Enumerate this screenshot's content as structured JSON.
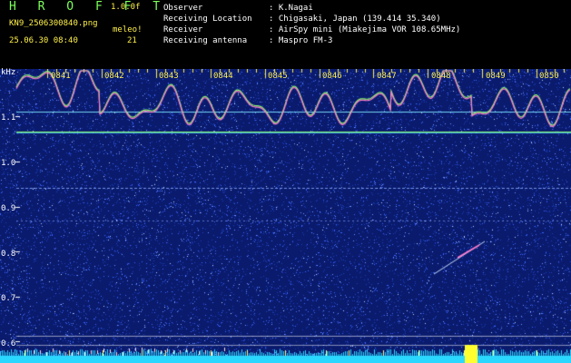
{
  "header": {
    "app_title": "H R O F F T",
    "version": "1.0.0f",
    "filename": "KN9_2506300840.png",
    "source": "meleo!",
    "timestamp": "25.06.30 08:40",
    "count": "21"
  },
  "info": [
    {
      "key": "Observer",
      "value": ": K.Nagai"
    },
    {
      "key": "Receiving Location",
      "value": ": Chigasaki, Japan (139.414 35.340)"
    },
    {
      "key": "Receiver",
      "value": ": AirSpy mini (Miakejima VOR 108.65MHz)"
    },
    {
      "key": "Receiving antenna",
      "value": ": Maspro FM-3"
    }
  ],
  "spectrogram": {
    "unit": "kHz",
    "y_ticks": [
      "1.1",
      "1.0",
      "0.9",
      "0.8",
      "0.7",
      "0.6"
    ],
    "x_ticks": [
      "0841",
      "0842",
      "0843",
      "0844",
      "0845",
      "0846",
      "0847",
      "0848",
      "0849",
      "0850"
    ],
    "colors": {
      "background": "#0a1b6e",
      "noise": "#3a66ff",
      "carrier": "#8cff6a",
      "doppler": "#ff7ad0",
      "tick": "#FFF04A",
      "bottom_band": "#2ad8ff",
      "burst": "#ffff30"
    }
  }
}
